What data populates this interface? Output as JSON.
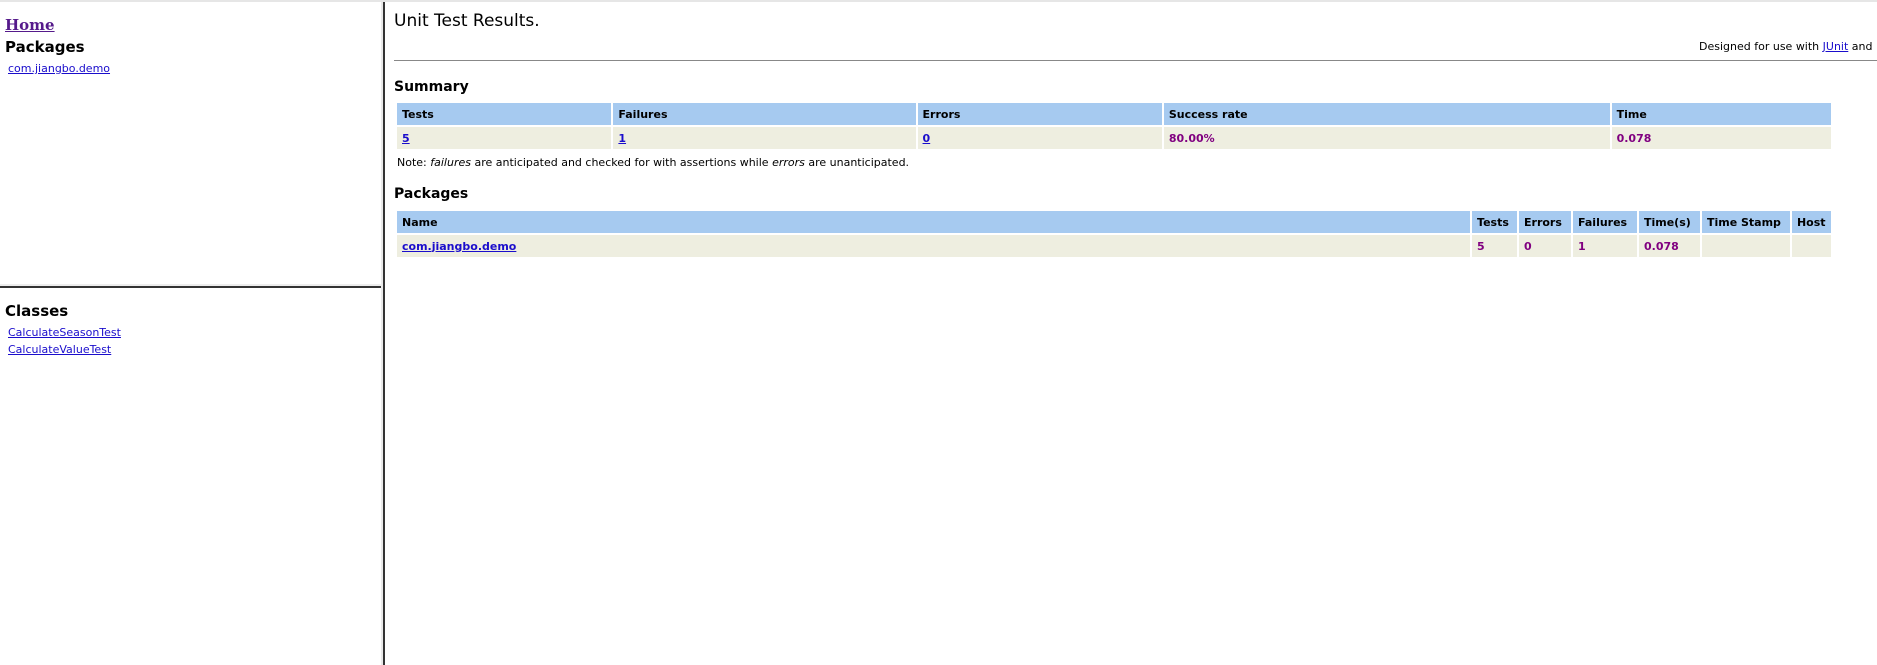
{
  "nav": {
    "home": "Home",
    "packages_heading": "Packages",
    "packages": [
      "com.jiangbo.demo"
    ],
    "classes_heading": "Classes",
    "classes": [
      "CalculateSeasonTest",
      "CalculateValueTest"
    ]
  },
  "main": {
    "title": "Unit Test Results.",
    "designed_prefix": "Designed for use with ",
    "designed_link": "JUnit",
    "designed_suffix": " and",
    "summary": {
      "heading": "Summary",
      "columns": [
        "Tests",
        "Failures",
        "Errors",
        "Success rate",
        "Time"
      ],
      "row": {
        "tests": "5",
        "failures": "1",
        "errors": "0",
        "success_rate": "80.00%",
        "time": "0.078"
      },
      "note_prefix": "Note: ",
      "note_failures": "failures",
      "note_middle": " are anticipated and checked for with assertions while ",
      "note_errors": "errors",
      "note_suffix": " are unanticipated."
    },
    "packages": {
      "heading": "Packages",
      "columns": [
        "Name",
        "Tests",
        "Errors",
        "Failures",
        "Time(s)",
        "Time Stamp",
        "Host"
      ],
      "rows": [
        {
          "name": "com.jiangbo.demo",
          "tests": "5",
          "errors": "0",
          "failures": "1",
          "time": "0.078",
          "timestamp": "",
          "host": ""
        }
      ]
    }
  },
  "colors": {
    "header_bg": "#a6caf0",
    "row_bg": "#eeeee0",
    "value_text": "#800080",
    "link": "#1a0dcc",
    "visited_link": "#551a8b"
  }
}
